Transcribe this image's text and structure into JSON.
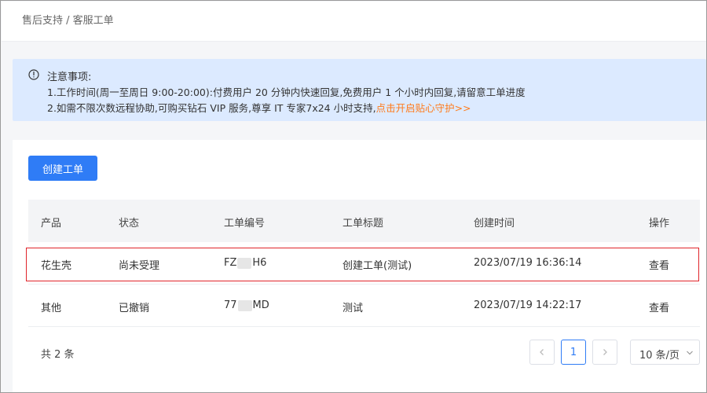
{
  "breadcrumb": {
    "text": "售后支持 / 客服工单"
  },
  "notice": {
    "title": "注意事项:",
    "line1": "1.工作时间(周一至周日 9:00-20:00):付费用户 20 分钟内快速回复,免费用户 1 个小时内回复,请留意工单进度",
    "line2_prefix": "2.如需不限次数远程协助,可购买钻石 VIP 服务,尊享 IT 专家7x24 小时支持,",
    "line2_link": "点击开启贴心守护>>",
    "link_color": "#ff7a1a"
  },
  "toolbar": {
    "create_label": "创建工单"
  },
  "table": {
    "headers": {
      "product": "产品",
      "status": "状态",
      "ticket_no": "工单编号",
      "ticket_title": "工单标题",
      "created_at": "创建时间",
      "action": "操作"
    },
    "rows": [
      {
        "product": "花生壳",
        "status": "尚未受理",
        "ticket_no_start": "FZ",
        "ticket_no_end": "H6",
        "title": "创建工单(测试)",
        "created_at": "2023/07/19 16:36:14",
        "action": "查看"
      },
      {
        "product": "其他",
        "status": "已撤销",
        "ticket_no_start": "77",
        "ticket_no_end": "MD",
        "title": "测试",
        "created_at": "2023/07/19 14:22:17",
        "action": "查看"
      }
    ]
  },
  "pagination": {
    "total": "共 2 条",
    "prev_icon": "chevron-left-icon",
    "current_page": "1",
    "next_icon": "chevron-right-icon",
    "page_size": "10 条/页"
  },
  "colors": {
    "accent": "#2f7cf6",
    "highlight_border": "#e0242a",
    "notice_bg": "#dceaff"
  }
}
